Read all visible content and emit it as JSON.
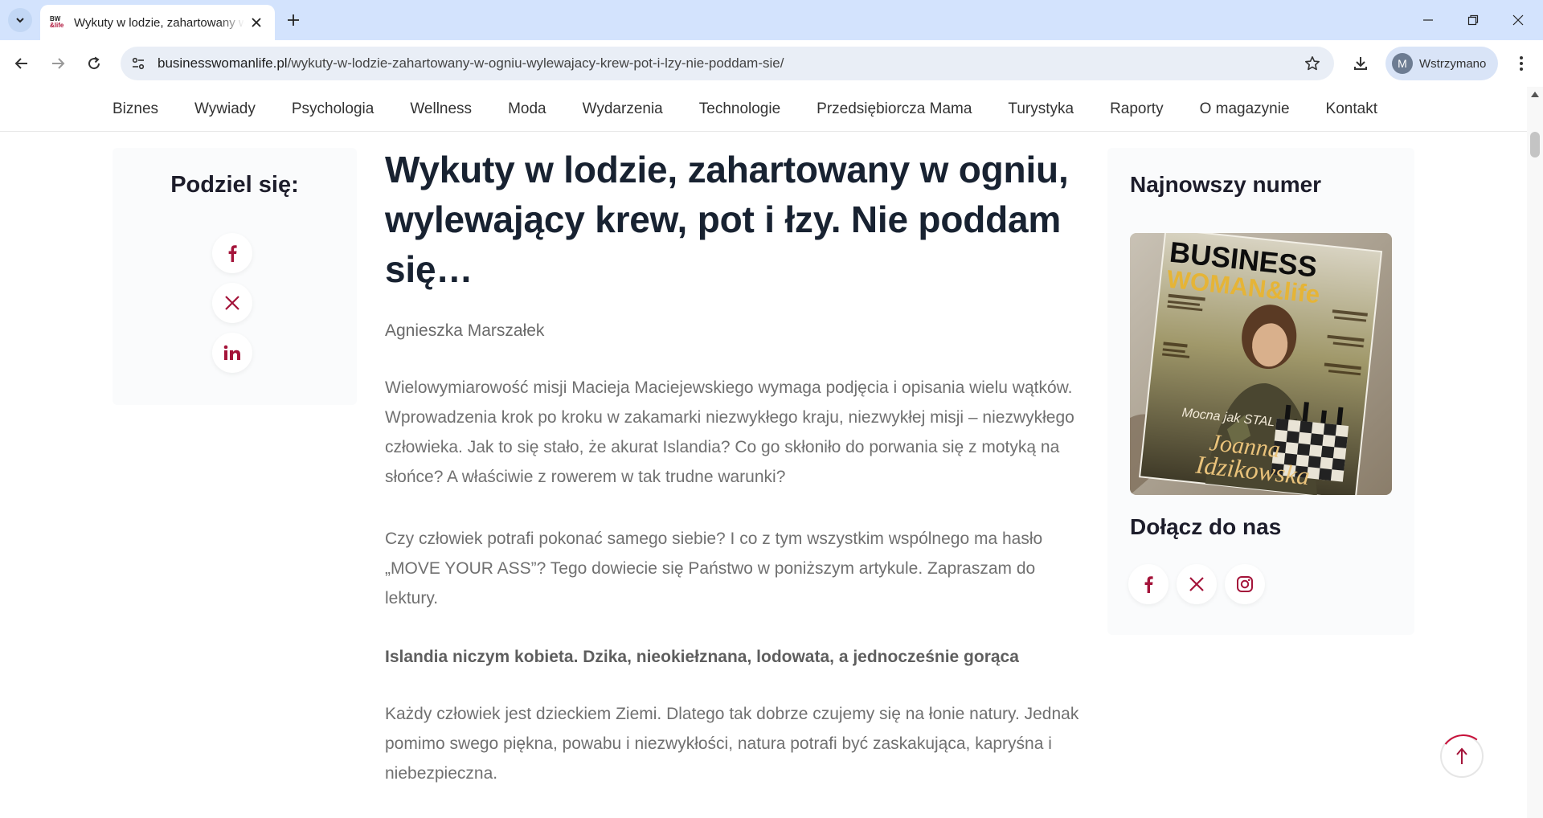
{
  "browser": {
    "tab_title": "Wykuty w lodzie, zahartowany w ogniu",
    "favicon_top": "BW",
    "favicon_bottom": "&life",
    "url_domain": "businesswomanlife.pl",
    "url_path": "/wykuty-w-lodzie-zahartowany-w-ogniu-wylewajacy-krew-pot-i-lzy-nie-poddam-sie/",
    "profile_initial": "M",
    "profile_label": "Wstrzymano"
  },
  "nav": {
    "items": [
      "Biznes",
      "Wywiady",
      "Psychologia",
      "Wellness",
      "Moda",
      "Wydarzenia",
      "Technologie",
      "Przedsiębiorcza Mama",
      "Turystyka",
      "Raporty",
      "O magazynie",
      "Kontakt"
    ]
  },
  "share": {
    "title": "Podziel się:",
    "icons": [
      "facebook-icon",
      "x-icon",
      "linkedin-icon"
    ]
  },
  "article": {
    "headline": "Wykuty w lodzie, zahartowany w ogniu, wylewający krew, pot i łzy. Nie poddam się…",
    "author": "Agnieszka Marszałek",
    "paragraph1": "Wielowymiarowość misji Macieja Maciejewskiego wymaga podjęcia i opisania wielu wątków. Wprowadzenia krok po kroku w zakamarki niezwykłego kraju, niezwykłej misji – niezwykłego człowieka. Jak to się stało, że akurat Islandia? Co go skłoniło do porwania się z motyką na słońce? A właściwie z rowerem w tak trudne warunki?",
    "paragraph2": "Czy człowiek potrafi pokonać samego siebie? I co z tym wszystkim wspólnego ma hasło „MOVE YOUR ASS”? Tego dowiecie się Państwo w poniższym artykule. Zapraszam do lektury.",
    "subheading": "Islandia niczym kobieta. Dzika, nieokiełznana, lodowata, a jednocześnie gorąca",
    "paragraph3": "Każdy człowiek jest dzieckiem Ziemi. Dlatego tak dobrze czujemy się na łonie natury. Jednak pomimo swego piękna, powabu i niezwykłości, natura potrafi być zaskakująca, kapryśna i niebezpieczna."
  },
  "sidebar": {
    "latest_issue_title": "Najnowszy numer",
    "join_title": "Dołącz do nas",
    "cover": {
      "brand_top": "BUSINESS",
      "brand_bottom": "WOMAN&life",
      "cover_name_1": "Joanna",
      "cover_name_2": "Idzikowska",
      "cover_tag": "Mocna jak STAL"
    },
    "social_icons": [
      "facebook-icon",
      "x-icon",
      "instagram-icon"
    ]
  },
  "colors": {
    "accent": "#a4143a",
    "headline": "#182231",
    "body_text": "#707070"
  }
}
